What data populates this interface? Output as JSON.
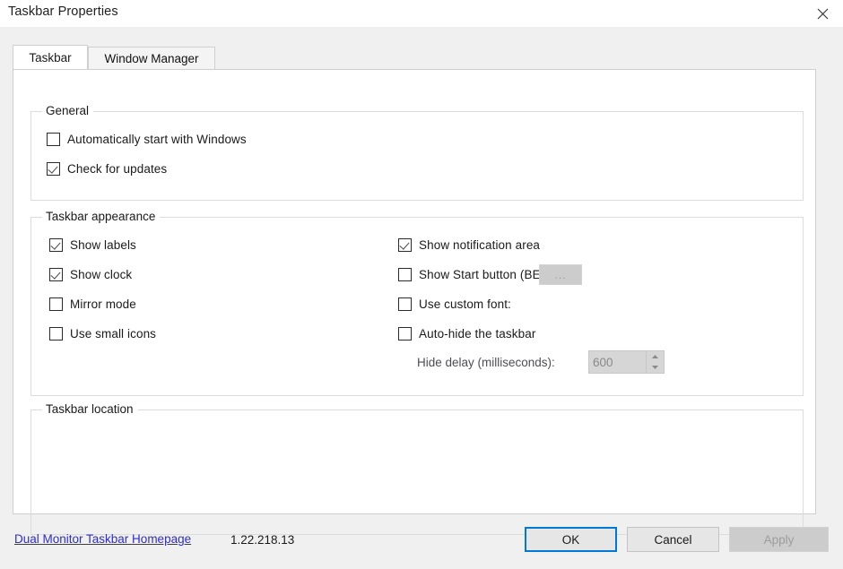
{
  "window": {
    "title": "Taskbar Properties",
    "close_icon": "close-icon"
  },
  "tabs": [
    {
      "label": "Taskbar",
      "selected": true
    },
    {
      "label": "Window Manager",
      "selected": false
    }
  ],
  "groups": {
    "general": {
      "legend": "General",
      "options": [
        {
          "label": "Automatically start with Windows",
          "checked": false
        },
        {
          "label": "Check for updates",
          "checked": true
        }
      ]
    },
    "appearance": {
      "legend": "Taskbar appearance",
      "left_options": [
        {
          "label": "Show labels",
          "checked": true
        },
        {
          "label": "Show clock",
          "checked": true
        },
        {
          "label": "Mirror mode",
          "checked": false
        },
        {
          "label": "Use small icons",
          "checked": false
        }
      ],
      "right_options": [
        {
          "label": "Show notification area",
          "checked": true
        },
        {
          "label": "Show Start button (BETA)",
          "checked": false
        },
        {
          "label": "Use custom font:",
          "checked": false
        },
        {
          "label": "Auto-hide the taskbar",
          "checked": false
        }
      ],
      "font_browse_label": "...",
      "hide_delay_label": "Hide delay (milliseconds):",
      "hide_delay_value": "600",
      "spin_up_icon": "chevron-up-icon",
      "spin_down_icon": "chevron-down-icon"
    },
    "location": {
      "legend": "Taskbar location"
    }
  },
  "footer": {
    "homepage_link": "Dual Monitor Taskbar Homepage",
    "version": "1.22.218.13",
    "ok_label": "OK",
    "cancel_label": "Cancel",
    "apply_label": "Apply"
  },
  "colors": {
    "accent": "#0078d7",
    "link": "#2b2bd8",
    "dialog_bg": "#f0f0f0",
    "panel_bg": "#ffffff",
    "disabled_text": "#9d9d9d"
  }
}
